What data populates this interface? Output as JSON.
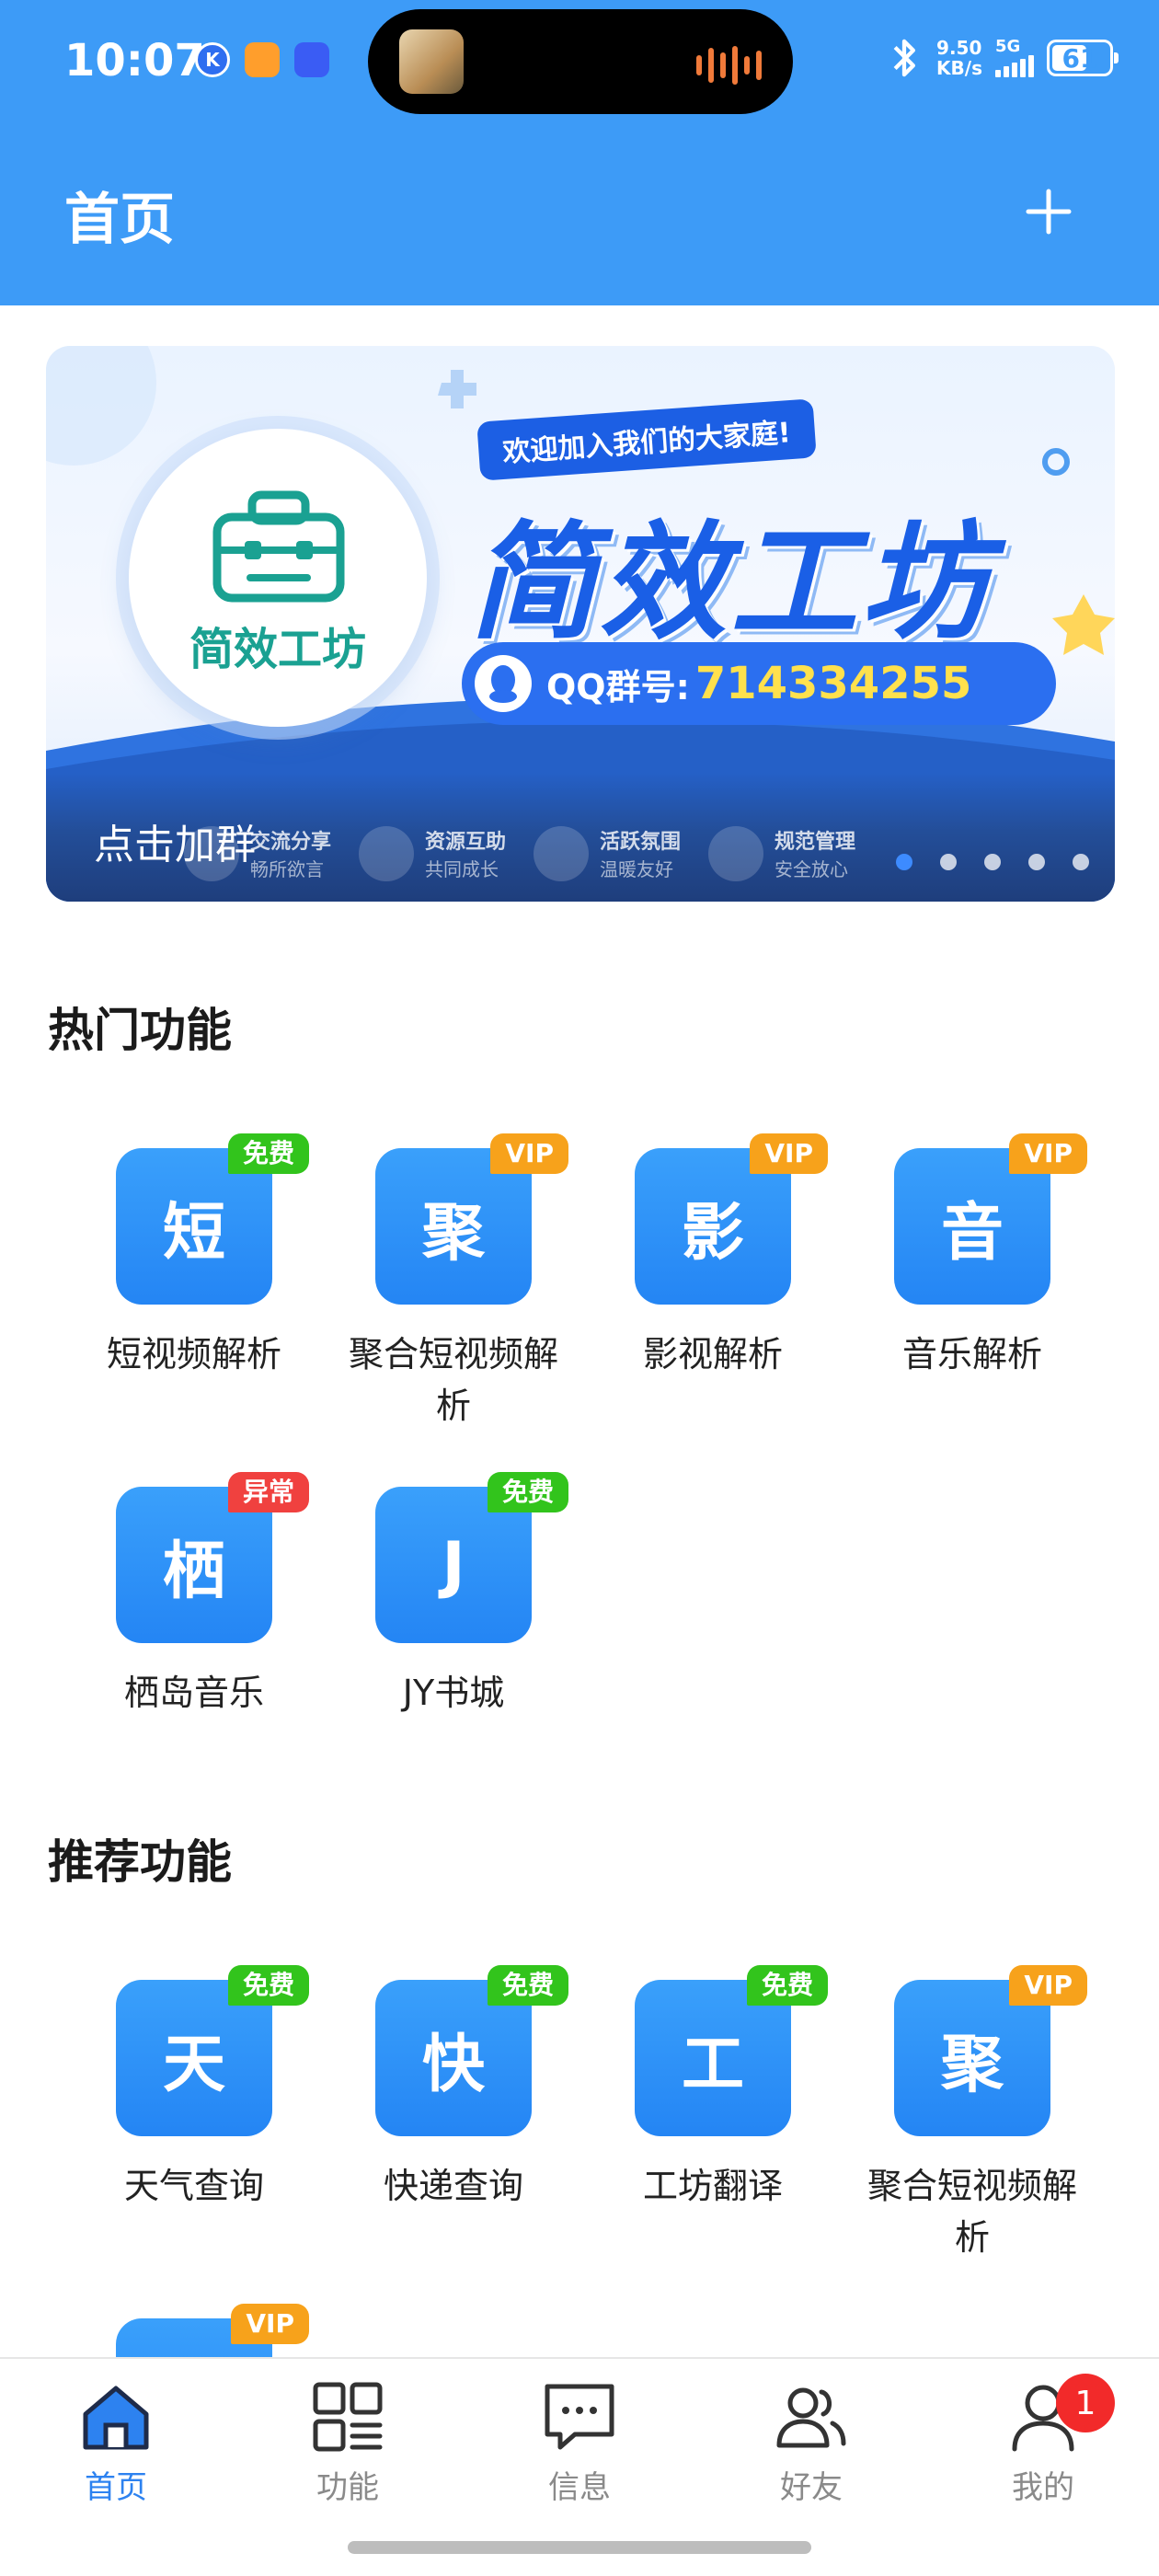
{
  "status_bar": {
    "time": "10:07",
    "net_speed_value": "9.50",
    "net_speed_unit": "KB/s",
    "signal": "5G",
    "battery": "61",
    "battery_level_percent": 61
  },
  "header": {
    "title": "首页",
    "add_icon": "plus-icon"
  },
  "banner": {
    "welcome": "欢迎加入我们的大家庭!",
    "brand": "简效工坊",
    "logo_text": "简效工坊",
    "qq_label": "QQ群号:",
    "qq_number": "714334255",
    "features": [
      {
        "title": "交流分享",
        "sub": "畅所欲言"
      },
      {
        "title": "资源互助",
        "sub": "共同成长"
      },
      {
        "title": "活跃氛围",
        "sub": "温暖友好"
      },
      {
        "title": "规范管理",
        "sub": "安全放心"
      }
    ],
    "caption": "点击加群",
    "dot_count": 5,
    "active_dot": 0
  },
  "hot_section": {
    "title": "热门功能",
    "items": [
      {
        "glyph": "短",
        "label": "短视频解析",
        "badge": "免费",
        "badge_color": "#32c41c"
      },
      {
        "glyph": "聚",
        "label": "聚合短视频解析",
        "badge": "VIP",
        "badge_color": "#f7a21b"
      },
      {
        "glyph": "影",
        "label": "影视解析",
        "badge": "VIP",
        "badge_color": "#f7a21b"
      },
      {
        "glyph": "音",
        "label": "音乐解析",
        "badge": "VIP",
        "badge_color": "#f7a21b"
      },
      {
        "glyph": "栖",
        "label": "栖岛音乐",
        "badge": "异常",
        "badge_color": "#f0413f"
      },
      {
        "glyph": "J",
        "label": "JY书城",
        "badge": "免费",
        "badge_color": "#32c41c"
      }
    ]
  },
  "recommend_section": {
    "title": "推荐功能",
    "items": [
      {
        "glyph": "天",
        "label": "天气查询",
        "badge": "免费",
        "badge_color": "#32c41c"
      },
      {
        "glyph": "快",
        "label": "快递查询",
        "badge": "免费",
        "badge_color": "#32c41c"
      },
      {
        "glyph": "工",
        "label": "工坊翻译",
        "badge": "免费",
        "badge_color": "#32c41c"
      },
      {
        "glyph": "聚",
        "label": "聚合短视频解析",
        "badge": "VIP",
        "badge_color": "#f7a21b"
      },
      {
        "glyph": "",
        "label": "",
        "badge": "VIP",
        "badge_color": "#f7a21b"
      }
    ]
  },
  "tab_bar": {
    "tabs": [
      {
        "label": "首页",
        "icon": "home-icon",
        "active": true
      },
      {
        "label": "功能",
        "icon": "grid-icon",
        "active": false
      },
      {
        "label": "信息",
        "icon": "message-icon",
        "active": false
      },
      {
        "label": "好友",
        "icon": "friends-icon",
        "active": false
      },
      {
        "label": "我的",
        "icon": "profile-icon",
        "active": false,
        "badge": "1"
      }
    ]
  },
  "colors": {
    "primary": "#3d9bf7",
    "tab_active": "#2d82f0",
    "badge_free": "#32c41c",
    "badge_vip": "#f7a21b",
    "badge_error": "#f0413f"
  }
}
